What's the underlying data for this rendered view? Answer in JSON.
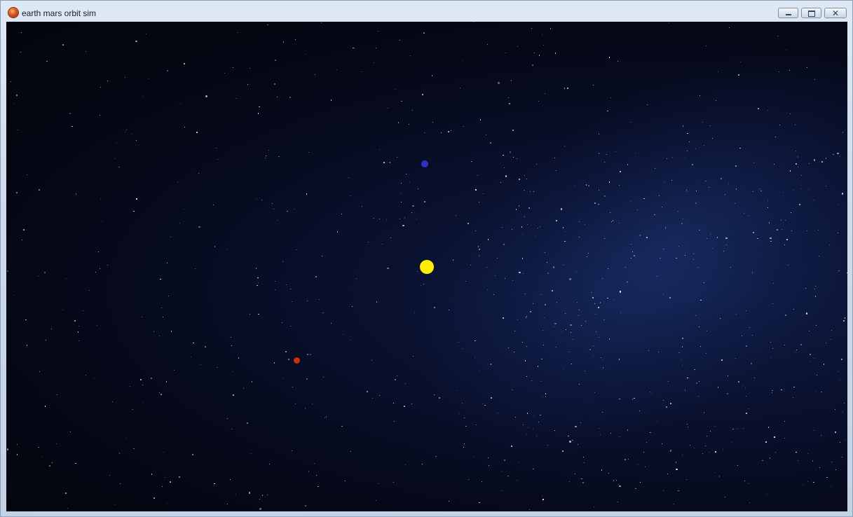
{
  "window": {
    "title": "earth mars orbit sim",
    "app_icon": "mars-planet-icon",
    "controls": {
      "minimize_icon": "minimize-icon",
      "maximize_icon": "maximize-icon",
      "close_icon": "close-icon"
    }
  },
  "scene": {
    "background": "starfield",
    "colors": {
      "sun": "#ffee00",
      "earth": "#2b33c8",
      "mars": "#c8300e"
    }
  }
}
